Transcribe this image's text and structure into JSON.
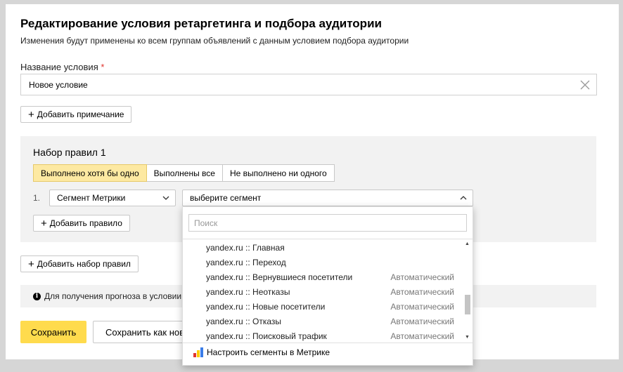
{
  "dialog": {
    "title": "Редактирование условия ретаргетинга и подбора аудитории",
    "subtitle": "Изменения будут применены ко всем группам объявлений с данным условием подбора аудитории"
  },
  "name_field": {
    "label": "Название условия",
    "required_mark": "*",
    "value": "Новое условие"
  },
  "add_note_label": "Добавить примечание",
  "ruleset": {
    "title": "Набор правил 1",
    "modes": [
      "Выполнено хотя бы одно",
      "Выполнены все",
      "Не выполнено ни одного"
    ],
    "active_mode": "Выполнено хотя бы одно",
    "rule": {
      "number": "1.",
      "type": "Сегмент Метрики",
      "segment_placeholder": "выберите сегмент"
    },
    "add_rule_label": "Добавить правило"
  },
  "add_ruleset_label": "Добавить набор правил",
  "info_text": "Для получения прогноза в условии д",
  "save_label": "Сохранить",
  "save_as_label": "Сохранить как ново",
  "dropdown": {
    "search_placeholder": "Поиск",
    "items": [
      {
        "name": "yandex.ru :: Главная",
        "tag": ""
      },
      {
        "name": "yandex.ru :: Переход",
        "tag": ""
      },
      {
        "name": "yandex.ru :: Вернувшиеся посетители",
        "tag": "Автоматический"
      },
      {
        "name": "yandex.ru :: Неотказы",
        "tag": "Автоматический"
      },
      {
        "name": "yandex.ru :: Новые посетители",
        "tag": "Автоматический"
      },
      {
        "name": "yandex.ru :: Отказы",
        "tag": "Автоматический"
      },
      {
        "name": "yandex.ru :: Поисковый трафик",
        "tag": "Автоматический"
      }
    ],
    "footer_label": "Настроить сегменты в Метрике"
  },
  "colors": {
    "accent_yellow": "#ffdb4d",
    "active_segment": "#fde9a2",
    "required": "#e0342e",
    "panel_bg": "#f2f2f2"
  }
}
